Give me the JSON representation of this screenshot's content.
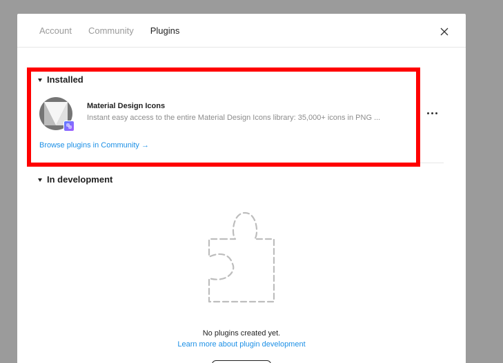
{
  "tabs": {
    "items": [
      {
        "label": "Account",
        "active": false
      },
      {
        "label": "Community",
        "active": false
      },
      {
        "label": "Plugins",
        "active": true
      }
    ]
  },
  "sections": {
    "installed": {
      "title": "Installed",
      "plugins": [
        {
          "name": "Material Design Icons",
          "description": "Instant easy access to the entire Material Design Icons library: 35,000+ icons in PNG ..."
        }
      ],
      "browse_link": "Browse plugins in Community →"
    },
    "development": {
      "title": "In development",
      "empty_text": "No plugins created yet.",
      "learn_link": "Learn more about plugin development"
    }
  },
  "colors": {
    "overlay": "#9b9b9b",
    "link": "#1b8fe6",
    "highlight": "#ff0000"
  },
  "icons": {
    "close": "close-icon",
    "more": "more-horizontal-icon",
    "plugin": "material-design-logo-icon",
    "badge": "plugin-badge-icon",
    "empty": "puzzle-piece-icon"
  }
}
